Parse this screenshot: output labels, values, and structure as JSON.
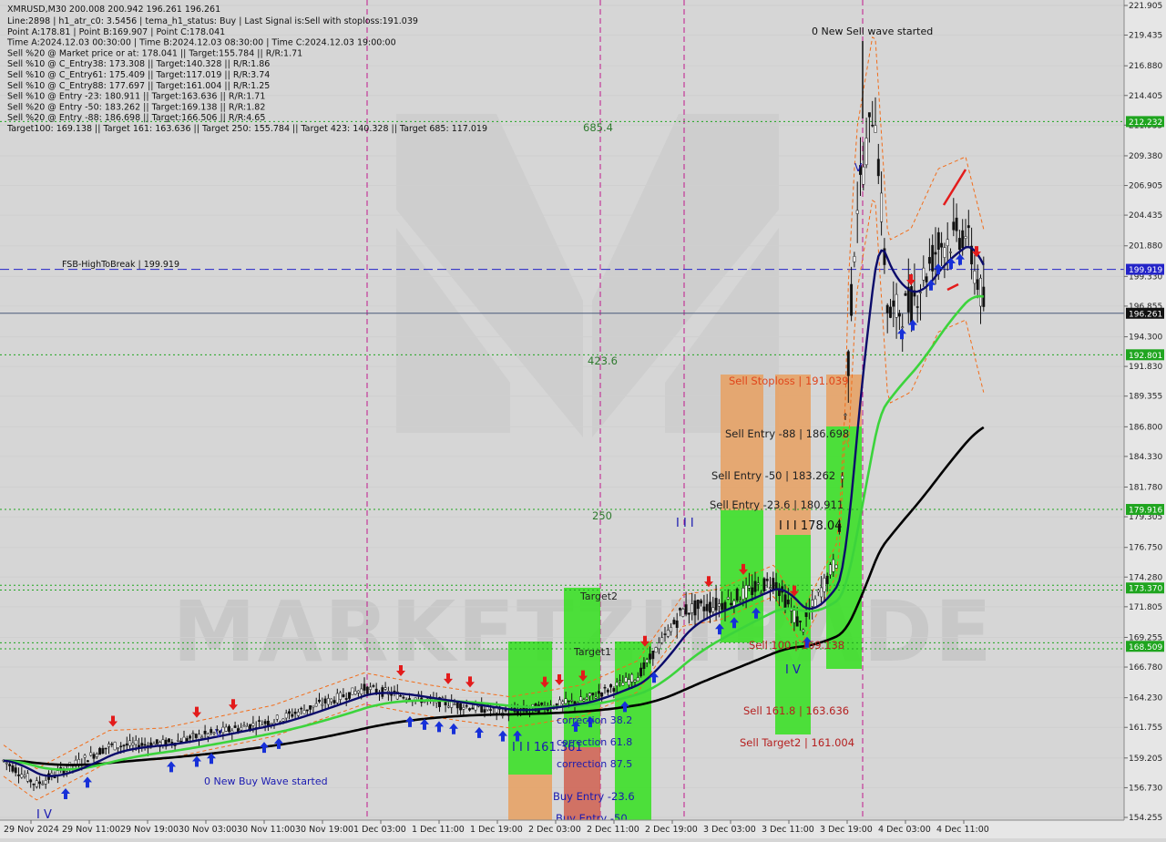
{
  "header": {
    "symbol_line": "XMRUSD,M30  200.008 200.942 196.261 196.261",
    "info_lines": [
      "Line:2898  |  h1_atr_c0: 3.5456  |  tema_h1_status: Buy  |  Last Signal is:Sell with stoploss:191.039",
      "Point A:178.81  |  Point B:169.907  |  Point C:178.041",
      "Time A:2024.12.03 00:30:00  |  Time B:2024.12.03 08:30:00  |  Time C:2024.12.03 19:00:00",
      "Sell %20 @ Market price or at: 178.041  ||  Target:155.784  ||  R/R:1.71",
      "Sell %10 @ C_Entry38: 173.308  ||  Target:140.328  ||  R/R:1.86",
      "Sell %10 @ C_Entry61: 175.409  ||  Target:117.019  ||  R/R:3.74",
      "Sell %10 @ C_Entry88: 177.697  ||  Target:161.004  ||  R/R:1.25",
      "Sell %10 @ Entry -23: 180.911  ||  Target:163.636  ||  R/R:1.71",
      "Sell %20 @ Entry -50: 183.262  ||  Target:169.138  ||  R/R:1.82",
      "Sell %20 @ Entry -88: 186.698  ||  Target:166.506  ||  R/R:4.65",
      "Target100: 169.138  ||  Target 161: 163.636  ||  Target 250: 155.784  ||  Target 423: 140.328  ||  Target 685: 117.019"
    ]
  },
  "watermark": "MARKETZITRADE",
  "chart_data": {
    "type": "candlestick",
    "symbol": "XMRUSD",
    "timeframe": "M30",
    "y_ticks": [
      221.905,
      219.435,
      216.88,
      214.405,
      211.935,
      209.38,
      206.905,
      204.435,
      201.88,
      199.33,
      196.855,
      194.3,
      191.83,
      189.355,
      186.8,
      184.33,
      181.78,
      179.305,
      176.75,
      174.28,
      171.805,
      169.255,
      166.78,
      164.23,
      161.755,
      159.205,
      156.73,
      154.255
    ],
    "x_ticks": [
      "29 Nov 2024",
      "29 Nov 11:00",
      "29 Nov 19:00",
      "30 Nov 03:00",
      "30 Nov 11:00",
      "30 Nov 19:00",
      "1 Dec 03:00",
      "1 Dec 11:00",
      "1 Dec 19:00",
      "2 Dec 03:00",
      "2 Dec 11:00",
      "2 Dec 19:00",
      "3 Dec 03:00",
      "3 Dec 11:00",
      "3 Dec 19:00",
      "4 Dec 03:00",
      "4 Dec 11:00"
    ],
    "price_badges": [
      {
        "value": "212.232",
        "price": 212.232,
        "color": "#1fa51f"
      },
      {
        "value": "199.919",
        "price": 199.919,
        "color": "#2424c8"
      },
      {
        "value": "196.261",
        "price": 196.261,
        "color": "#111111"
      },
      {
        "value": "192.801",
        "price": 192.801,
        "color": "#1fa51f"
      },
      {
        "value": "179.916",
        "price": 179.916,
        "color": "#1fa51f"
      },
      {
        "value": "173.370",
        "price": 173.37,
        "color": "#1fa51f"
      },
      {
        "value": "168.509",
        "price": 168.509,
        "color": "#1fa51f"
      }
    ],
    "h_lines": [
      {
        "price": 212.232,
        "style": "dotted",
        "color": "#1fa51f"
      },
      {
        "price": 199.919,
        "style": "dashed",
        "color": "#2424c8"
      },
      {
        "price": 196.261,
        "style": "solid",
        "color": "#4a5a7a"
      },
      {
        "price": 192.801,
        "style": "dotted",
        "color": "#1fa51f"
      },
      {
        "price": 179.916,
        "style": "dotted",
        "color": "#1fa51f"
      },
      {
        "price": 173.6,
        "style": "dotted",
        "color": "#1fa51f"
      },
      {
        "price": 173.2,
        "style": "dotted",
        "color": "#1fa51f"
      },
      {
        "price": 168.8,
        "style": "dotted",
        "color": "#1fa51f"
      },
      {
        "price": 168.3,
        "style": "dotted",
        "color": "#1fa51f"
      }
    ],
    "session_lines_x_index": [
      6,
      11,
      14
    ],
    "labels": [
      {
        "text": "0 New Sell wave started",
        "color": "#111111"
      },
      {
        "text": "FSB-HighToBreak  |  199.919",
        "color": "#111111"
      },
      {
        "text": "685.4",
        "color": "#2f7a2f"
      },
      {
        "text": "423.6",
        "color": "#2f7a2f"
      },
      {
        "text": "250",
        "color": "#2f7a2f"
      },
      {
        "text": "Sell Stoploss | 191.039",
        "color": "#e0451b"
      },
      {
        "text": "Sell Entry -88 | 186.698",
        "color": "#222222"
      },
      {
        "text": "Sell Entry -50 | 183.262",
        "color": "#222222"
      },
      {
        "text": "Sell Entry -23.6 | 180.911",
        "color": "#222222"
      },
      {
        "text": "I I I 178.04",
        "color": "#111111"
      },
      {
        "text": "Sell 100 | 169.138",
        "color": "#b52020"
      },
      {
        "text": "Sell 161.8 | 163.636",
        "color": "#b52020"
      },
      {
        "text": "Sell Target2 | 161.004",
        "color": "#b52020"
      },
      {
        "text": "Target2",
        "color": "#222222"
      },
      {
        "text": "Target1",
        "color": "#222222"
      },
      {
        "text": "correction 38.2",
        "color": "#1a1ab0"
      },
      {
        "text": "correction 61.8",
        "color": "#1a1ab0"
      },
      {
        "text": "correction 87.5",
        "color": "#1a1ab0"
      },
      {
        "text": "I I I 161.361",
        "color": "#1a1ab0"
      },
      {
        "text": "Buy Entry -23.6",
        "color": "#1a1ab0"
      },
      {
        "text": "Buy Entry -50",
        "color": "#1a1ab0"
      },
      {
        "text": "0 New Buy Wave started",
        "color": "#1a1ab0"
      },
      {
        "text": "I V",
        "color": "#1a1ab0"
      },
      {
        "text": "I V",
        "color": "#1a1ab0"
      },
      {
        "text": "V",
        "color": "#1a1ab0"
      },
      {
        "text": "V",
        "color": "#1a1ab0"
      },
      {
        "text": "I I I",
        "color": "#1a1ab0"
      }
    ],
    "colors": {
      "background": "#d6d6d6",
      "axis_bg": "#e6e6e6",
      "bull_candle": "#ffffff",
      "bear_candle": "#111111",
      "ma_fast": "#0b0b6a",
      "ma_mid": "#3cd43c",
      "ma_slow": "#000000",
      "envelope": "#f26d1a",
      "zone_green": "#34e01e",
      "zone_orange": "#e8a060",
      "zone_red": "#d06050",
      "session_line": "#c0188c"
    }
  }
}
